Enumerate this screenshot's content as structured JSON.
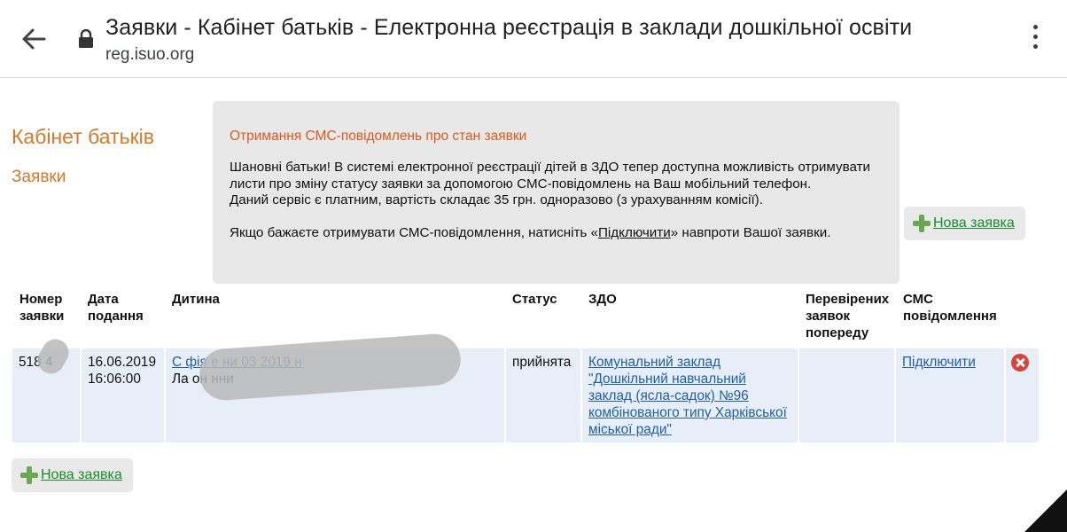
{
  "browser": {
    "title": "Заявки - Кабінет батьків - Електронна реєстрація в заклади дошкільної освіти",
    "url": "reg.isuo.org"
  },
  "page": {
    "cabinet_title": "Кабінет батьків",
    "requests_title": "Заявки"
  },
  "notice": {
    "title": "Отримання СМС-повідомлень про стан заявки",
    "line1": "Шановні батьки! В системі електронної реєстрації дітей в ЗДО тепер доступна можливість отримувати листи про зміну статусу заявки за допомогою СМС-повідомлень на Ваш мобільний телефон.",
    "line2": "Даний сервіс є платним, вартість складає 35 грн. одноразово (з урахуванням комісії).",
    "line3_before": "Якщо бажаєте отримувати СМС-повідомлення, натисніть «",
    "line3_link": "Підключити",
    "line3_after": "» навпроти Вашої заявки."
  },
  "new_request_label": "Нова заявка",
  "table": {
    "headers": {
      "number": "Номер заявки",
      "date": "Дата подання",
      "child": "Дитина",
      "status": "Статус",
      "zdo": "ЗДО",
      "checked": "Перевірених заявок попереду",
      "sms": "СМС повідомлення"
    },
    "row": {
      "number": "518 4",
      "date": "16.06.2019",
      "time": "16:06:00",
      "child_line1": "С фія     е              ни  03 2019    н",
      "child_line2": "Ла                        он      нни",
      "status": "прийнята",
      "zdo": "Комунальний заклад \"Дошкільний навчальний заклад (ясла-садок) №96 комбінованого типу Харківської міської ради\"",
      "checked": "",
      "sms": "Підключити"
    }
  },
  "colors": {
    "accent_orange": "#d27a26",
    "notice_title": "#d85a1e",
    "link_blue": "#1d5fa8",
    "link_green": "#1a8a2a",
    "row_bg": "#e8eef8"
  }
}
